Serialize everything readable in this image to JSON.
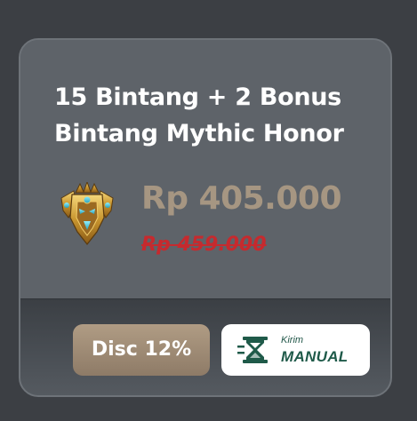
{
  "product": {
    "title": "15 Bintang + 2 Bonus Bintang Mythic Honor",
    "icon": "mythic-honor-emblem-icon",
    "price": "Rp 405.000",
    "original_price": "Rp 459.000"
  },
  "badges": {
    "discount": "Disc 12%",
    "delivery_small": "Kirim",
    "delivery_big": "MANUAL",
    "delivery_icon": "hourglass-icon"
  },
  "colors": {
    "page_bg": "#3c3f44",
    "card_bg": "#5d6268",
    "price": "#a69682",
    "original_price": "#c62a2e",
    "discount_badge": "#9e8a75",
    "delivery_accent": "#1f5a49"
  }
}
